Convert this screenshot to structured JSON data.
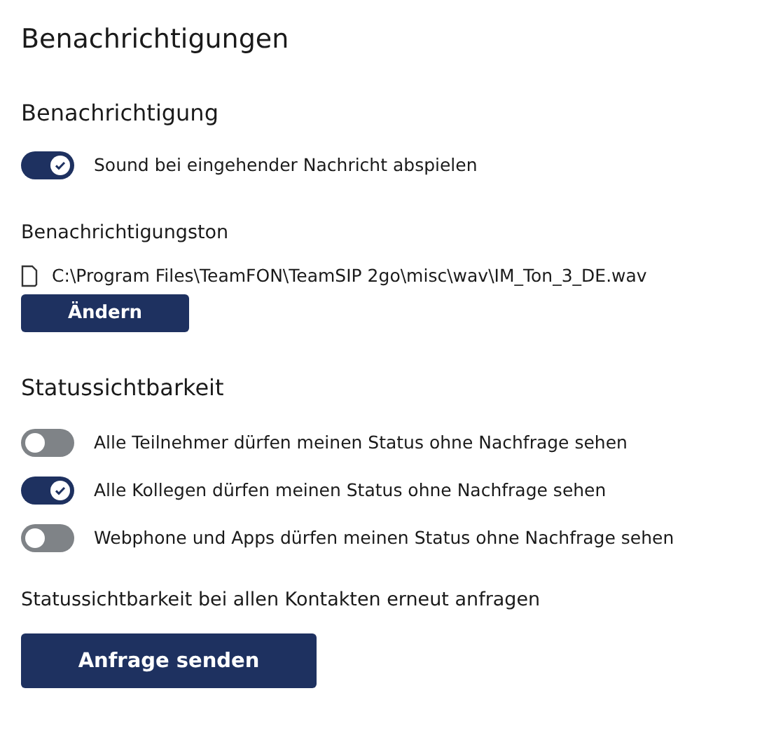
{
  "title": "Benachrichtigungen",
  "notification": {
    "heading": "Benachrichtigung",
    "toggles": [
      {
        "label": "Sound bei eingehender Nachricht abspielen",
        "on": true
      }
    ]
  },
  "sound": {
    "heading": "Benachrichtigungston",
    "file": "C:\\Program Files\\TeamFON\\TeamSIP 2go\\misc\\wav\\IM_Ton_3_DE.wav",
    "button": "Ändern"
  },
  "visibility": {
    "heading": "Statussichtbarkeit",
    "toggles": [
      {
        "label": "Alle Teilnehmer dürfen meinen Status ohne Nachfrage sehen",
        "on": false
      },
      {
        "label": "Alle Kollegen dürfen meinen Status ohne Nachfrage sehen",
        "on": true
      },
      {
        "label": "Webphone und Apps dürfen meinen Status ohne Nachfrage sehen",
        "on": false
      }
    ]
  },
  "request": {
    "text": "Statussichtbarkeit bei allen Kontakten erneut anfragen",
    "button": "Anfrage senden"
  }
}
